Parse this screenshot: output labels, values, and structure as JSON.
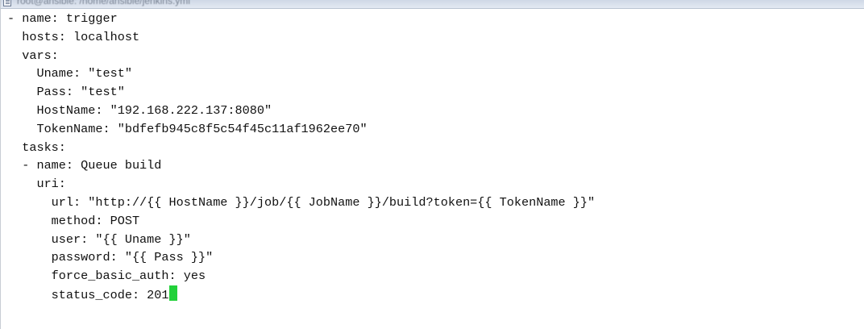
{
  "window": {
    "title": "root@ansible: /home/ansible/jenkins.yml"
  },
  "editor": {
    "lines": [
      "- name: trigger",
      "  hosts: localhost",
      "  vars:",
      "    Uname: \"test\"",
      "    Pass: \"test\"",
      "    HostName: \"192.168.222.137:8080\"",
      "    TokenName: \"bdfefb945c8f5c54f45c11af1962ee70\"",
      "  tasks:",
      "  - name: Queue build",
      "    uri:",
      "      url: \"http://{{ HostName }}/job/{{ JobName }}/build?token={{ TokenName }}\"",
      "      method: POST",
      "      user: \"{{ Uname }}\"",
      "      password: \"{{ Pass }}\"",
      "      force_basic_auth: yes",
      "      status_code: 201"
    ],
    "cursor_color": "#22d13a"
  }
}
